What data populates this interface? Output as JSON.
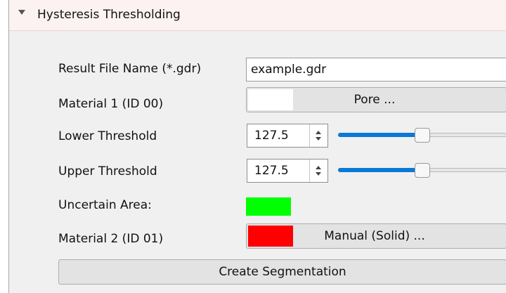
{
  "section": {
    "title": "Hysteresis Thresholding",
    "toggle_icon": "triangle-down-icon"
  },
  "result_file": {
    "label": "Result File Name (*.gdr)",
    "value": "example.gdr"
  },
  "material1": {
    "label": "Material 1 (ID 00)",
    "button_label": "Pore ...",
    "color": "#ffffff"
  },
  "lower_threshold": {
    "label": "Lower Threshold",
    "value": "127.5",
    "slider_fraction": 0.5
  },
  "upper_threshold": {
    "label": "Upper Threshold",
    "value": "127.5",
    "slider_fraction": 0.5
  },
  "uncertain_area": {
    "label": "Uncertain Area:",
    "color": "#00ff00"
  },
  "material2": {
    "label": "Material 2 (ID 01)",
    "button_label": "Manual (Solid) ...",
    "color": "#ff0000"
  },
  "create_button": {
    "label": "Create Segmentation"
  },
  "colors": {
    "slider_accent": "#0a78d7",
    "panel_bg": "#f0f0f0",
    "header_bg": "#fdf2f2"
  }
}
